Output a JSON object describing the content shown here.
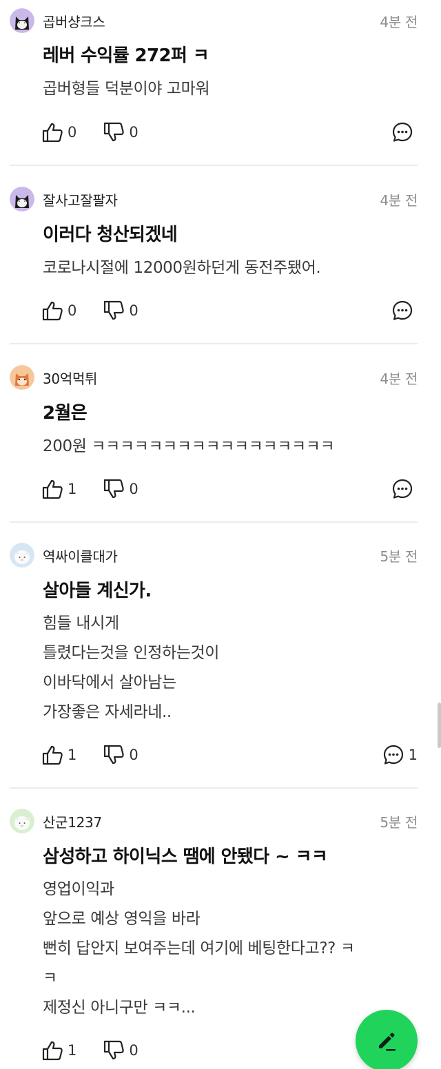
{
  "posts": [
    {
      "author": "곱버샹크스",
      "time": "4분 전",
      "avatar": "black-cat-avatar",
      "title": "레버 수익률 272퍼 ㅋ",
      "body": [
        "곱버형들 덕분이야 고마워"
      ],
      "likes": "0",
      "dislikes": "0",
      "comments": ""
    },
    {
      "author": "잘사고잘팔자",
      "time": "4분 전",
      "avatar": "black-cat-avatar",
      "title": "이러다 청산되겠네",
      "body": [
        "코로나시절에 12000원하던게 동전주됐어."
      ],
      "likes": "0",
      "dislikes": "0",
      "comments": ""
    },
    {
      "author": "30억먹튀",
      "time": "4분 전",
      "avatar": "orange-fox-avatar",
      "title": "2월은",
      "body": [
        "200원 ㅋㅋㅋㅋㅋㅋㅋㅋㅋㅋㅋㅋㅋㅋㅋㅋㅋ"
      ],
      "likes": "1",
      "dislikes": "0",
      "comments": ""
    },
    {
      "author": "역싸이클대가",
      "time": "5분 전",
      "avatar": "white-sheep-avatar",
      "title": "살아들 계신가.",
      "body": [
        "힘들 내시게",
        "틀렸다는것을 인정하는것이",
        "이바닥에서 살아남는",
        "가장좋은 자세라네.."
      ],
      "likes": "1",
      "dislikes": "0",
      "comments": "1"
    },
    {
      "author": "산군1237",
      "time": "5분 전",
      "avatar": "white-sheep-avatar-green",
      "title": "삼성하고 하이닉스 땜에 안됐다 ~ ㅋㅋ",
      "body": [
        "영업이익과",
        "앞으로 예상 영익을 바라",
        "뻔히 답안지 보여주는데 여기에 베팅한다고?? ㅋ",
        "ㅋ",
        "제정신 아니구만 ㅋㅋ..."
      ],
      "likes": "1",
      "dislikes": "0",
      "comments": ""
    }
  ],
  "icons": {
    "like": "thumbs-up-icon",
    "dislike": "thumbs-down-icon",
    "comment": "comment-bubble-icon",
    "write": "pencil-icon"
  },
  "colors": {
    "fab": "#1fd35b",
    "time": "#8c8c8c",
    "divider": "#ececec"
  }
}
